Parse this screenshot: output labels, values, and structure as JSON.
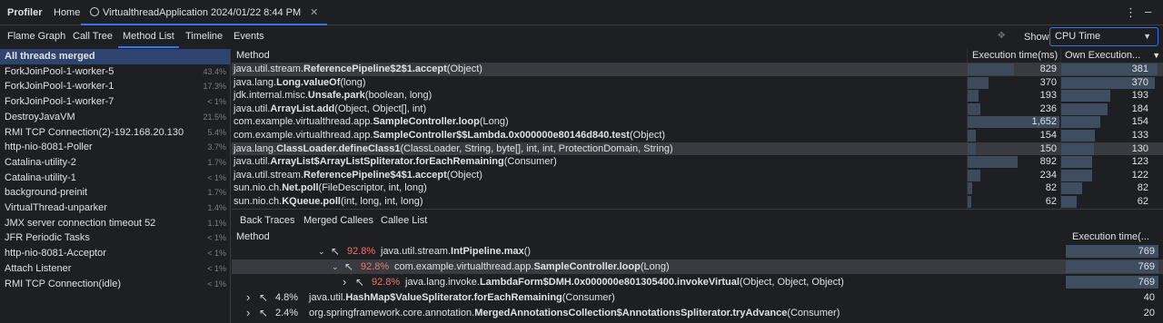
{
  "app_title": "Profiler",
  "top_tabs": [
    {
      "label": "Home"
    },
    {
      "label": "VirtualthreadApplication 2024/01/22 8:44 PM"
    }
  ],
  "view_tabs": [
    "Flame Graph",
    "Call Tree",
    "Method List",
    "Timeline",
    "Events"
  ],
  "active_view_tab": "Method List",
  "show": {
    "label": "Show:",
    "value": "CPU Time"
  },
  "threads": [
    {
      "name": "All threads merged",
      "pct": ""
    },
    {
      "name": "ForkJoinPool-1-worker-5",
      "pct": "43.4%"
    },
    {
      "name": "ForkJoinPool-1-worker-1",
      "pct": "17.3%"
    },
    {
      "name": "ForkJoinPool-1-worker-7",
      "pct": "< 1%"
    },
    {
      "name": "DestroyJavaVM",
      "pct": "21.5%"
    },
    {
      "name": "RMI TCP Connection(2)-192.168.20.130",
      "pct": "5.4%"
    },
    {
      "name": "http-nio-8081-Poller",
      "pct": "3.7%"
    },
    {
      "name": "Catalina-utility-2",
      "pct": "1.7%"
    },
    {
      "name": "Catalina-utility-1",
      "pct": "< 1%"
    },
    {
      "name": "background-preinit",
      "pct": "1.7%"
    },
    {
      "name": "VirtualThread-unparker",
      "pct": "1.4%"
    },
    {
      "name": "JMX server connection timeout 52",
      "pct": "1.1%"
    },
    {
      "name": "JFR Periodic Tasks",
      "pct": "< 1%"
    },
    {
      "name": "http-nio-8081-Acceptor",
      "pct": "< 1%"
    },
    {
      "name": "Attach Listener",
      "pct": "< 1%"
    },
    {
      "name": "RMI TCP Connection(idle)",
      "pct": "< 1%"
    }
  ],
  "method_table": {
    "headers": {
      "method": "Method",
      "exec": "Execution time(ms)",
      "own": "Own Execution..."
    },
    "max_exec": 1652,
    "max_own": 381,
    "rows": [
      {
        "pre": "java.util.stream.",
        "bold": "ReferencePipeline$2$1.accept",
        "post": "(Object)",
        "exec": 829,
        "own": 381,
        "exec_label": "829",
        "own_label": "381"
      },
      {
        "pre": "java.lang.",
        "bold": "Long.valueOf",
        "post": "(long)",
        "exec": 370,
        "own": 370,
        "exec_label": "370",
        "own_label": "370"
      },
      {
        "pre": "jdk.internal.misc.",
        "bold": "Unsafe.park",
        "post": "(boolean, long)",
        "exec": 193,
        "own": 193,
        "exec_label": "193",
        "own_label": "193"
      },
      {
        "pre": "java.util.",
        "bold": "ArrayList.add",
        "post": "(Object, Object[], int)",
        "exec": 236,
        "own": 184,
        "exec_label": "236",
        "own_label": "184"
      },
      {
        "pre": "com.example.virtualthread.app.",
        "bold": "SampleController.loop",
        "post": "(Long)",
        "exec": 1652,
        "own": 154,
        "exec_label": "1,652",
        "own_label": "154"
      },
      {
        "pre": "com.example.virtualthread.app.",
        "bold": "SampleController$$Lambda.0x000000e80146d840.test",
        "post": "(Object)",
        "exec": 154,
        "own": 133,
        "exec_label": "154",
        "own_label": "133"
      },
      {
        "pre": "java.lang.",
        "bold": "ClassLoader.defineClass1",
        "post": "(ClassLoader, String, byte[], int, int, ProtectionDomain, String)",
        "exec": 150,
        "own": 130,
        "exec_label": "150",
        "own_label": "130"
      },
      {
        "pre": "java.util.",
        "bold": "ArrayList$ArrayListSpliterator.forEachRemaining",
        "post": "(Consumer)",
        "exec": 892,
        "own": 123,
        "exec_label": "892",
        "own_label": "123"
      },
      {
        "pre": "java.util.stream.",
        "bold": "ReferencePipeline$4$1.accept",
        "post": "(Object)",
        "exec": 234,
        "own": 122,
        "exec_label": "234",
        "own_label": "122"
      },
      {
        "pre": "sun.nio.ch.",
        "bold": "Net.poll",
        "post": "(FileDescriptor, int, long)",
        "exec": 82,
        "own": 82,
        "exec_label": "82",
        "own_label": "82"
      },
      {
        "pre": "sun.nio.ch.",
        "bold": "KQueue.poll",
        "post": "(int, long, int, long)",
        "exec": 62,
        "own": 62,
        "exec_label": "62",
        "own_label": "62"
      }
    ]
  },
  "bottom_tabs": [
    "Back Traces",
    "Merged Callees",
    "Callee List"
  ],
  "active_bottom_tab": "Back Traces",
  "back_traces": {
    "headers": {
      "method": "Method",
      "exec": "Execution time(..."
    },
    "rows": [
      {
        "pct": "92.8%",
        "pre": "java.util.stream.",
        "bold": "IntPipeline.max",
        "post": "()",
        "value": "769",
        "expanded": true,
        "hot": true
      },
      {
        "pct": "92.8%",
        "pre": "com.example.virtualthread.app.",
        "bold": "SampleController.loop",
        "post": "(Long)",
        "value": "769",
        "expanded": true,
        "hot": true
      },
      {
        "pct": "92.8%",
        "pre": "java.lang.invoke.",
        "bold": "LambdaForm$DMH.0x000000e801305400.invokeVirtual",
        "post": "(Object, Object, Object)",
        "value": "769",
        "expanded": false,
        "hot": true
      },
      {
        "pct": "4.8%",
        "pre": "java.util.",
        "bold": "HashMap$ValueSpliterator.forEachRemaining",
        "post": "(Consumer)",
        "value": "40",
        "expanded": false,
        "hot": false
      },
      {
        "pct": "2.4%",
        "pre": "org.springframework.core.annotation.",
        "bold": "MergedAnnotationsCollection$AnnotationsSpliterator.tryAdvance",
        "post": "(Consumer)",
        "value": "20",
        "expanded": false,
        "hot": false
      }
    ]
  },
  "colors": {
    "accent": "#3574f0",
    "hot_pct": "#f3736b",
    "bar": "#3d4a5c"
  }
}
